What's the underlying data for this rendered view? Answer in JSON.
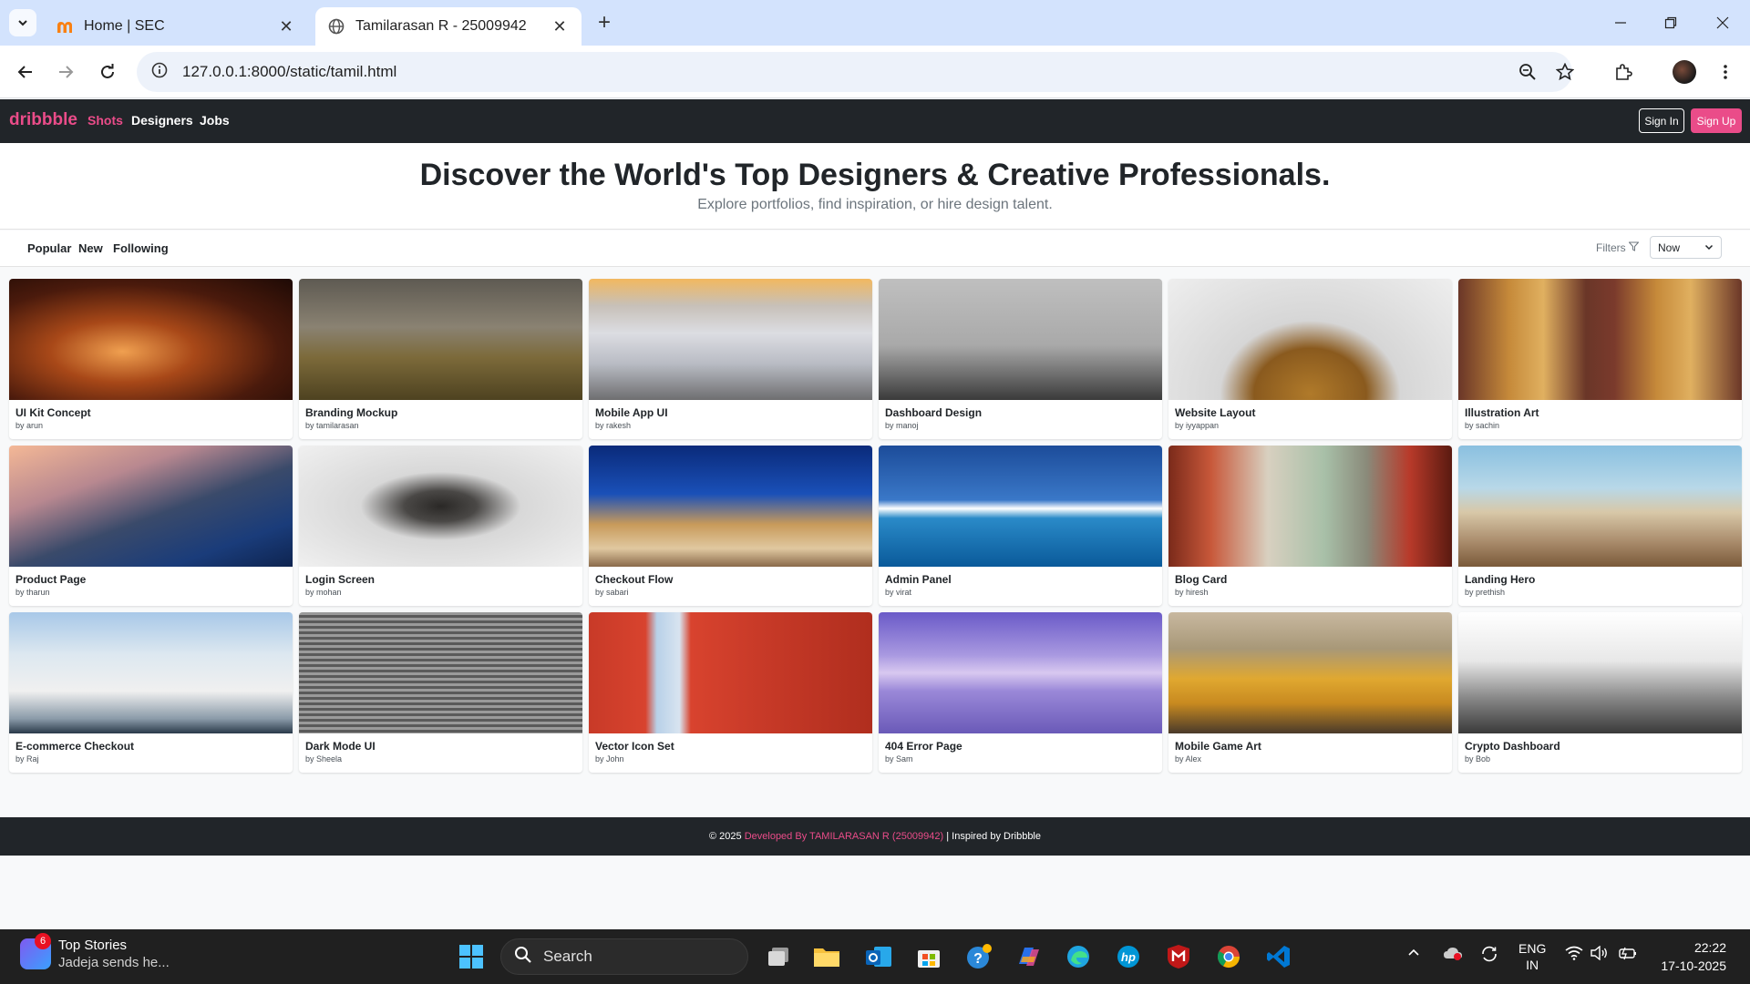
{
  "browser": {
    "tabs": [
      {
        "title": "Home | SEC",
        "favicon": "moodle-icon"
      },
      {
        "title": "Tamilarasan R - 25009942",
        "favicon": "globe-icon"
      }
    ],
    "url": "127.0.0.1:8000/static/tamil.html"
  },
  "site": {
    "brand": "dribbble",
    "nav": [
      "Shots",
      "Designers",
      "Jobs"
    ],
    "sign_in": "Sign In",
    "sign_up": "Sign Up",
    "hero_title": "Discover the World's Top Designers & Creative Professionals.",
    "hero_subtitle": "Explore portfolios, find inspiration, or hire design talent.",
    "filter_tabs": [
      "Popular",
      "New",
      "Following"
    ],
    "filters_label": "Filters",
    "sort_value": "Now",
    "cards": [
      {
        "title": "UI Kit Concept",
        "author": "by arun"
      },
      {
        "title": "Branding Mockup",
        "author": "by tamilarasan"
      },
      {
        "title": "Mobile App UI",
        "author": "by rakesh"
      },
      {
        "title": "Dashboard Design",
        "author": "by manoj"
      },
      {
        "title": "Website Layout",
        "author": "by iyyappan"
      },
      {
        "title": "Illustration Art",
        "author": "by sachin"
      },
      {
        "title": "Product Page",
        "author": "by tharun"
      },
      {
        "title": "Login Screen",
        "author": "by mohan"
      },
      {
        "title": "Checkout Flow",
        "author": "by sabari"
      },
      {
        "title": "Admin Panel",
        "author": "by virat"
      },
      {
        "title": "Blog Card",
        "author": "by hiresh"
      },
      {
        "title": "Landing Hero",
        "author": "by prethish"
      },
      {
        "title": "E-commerce Checkout",
        "author": "by Raj"
      },
      {
        "title": "Dark Mode UI",
        "author": "by Sheela"
      },
      {
        "title": "Vector Icon Set",
        "author": "by John"
      },
      {
        "title": "404 Error Page",
        "author": "by Sam"
      },
      {
        "title": "Mobile Game Art",
        "author": "by Alex"
      },
      {
        "title": "Crypto Dashboard",
        "author": "by Bob"
      }
    ],
    "footer": {
      "prefix": "© 2025",
      "highlight": "Developed By TAMILARASAN R (25009942)",
      "suffix": "| Inspired by Dribbble"
    }
  },
  "taskbar": {
    "news_badge": "6",
    "news_title": "Top Stories",
    "news_subtitle": "Jadeja sends he...",
    "search_placeholder": "Search",
    "language": "ENG",
    "region": "IN",
    "time": "22:22",
    "date": "17-10-2025"
  },
  "colors": {
    "brand_pink": "#ea4c89",
    "navbar_dark": "#212529",
    "tabbar_blue": "#d3e3fd"
  }
}
